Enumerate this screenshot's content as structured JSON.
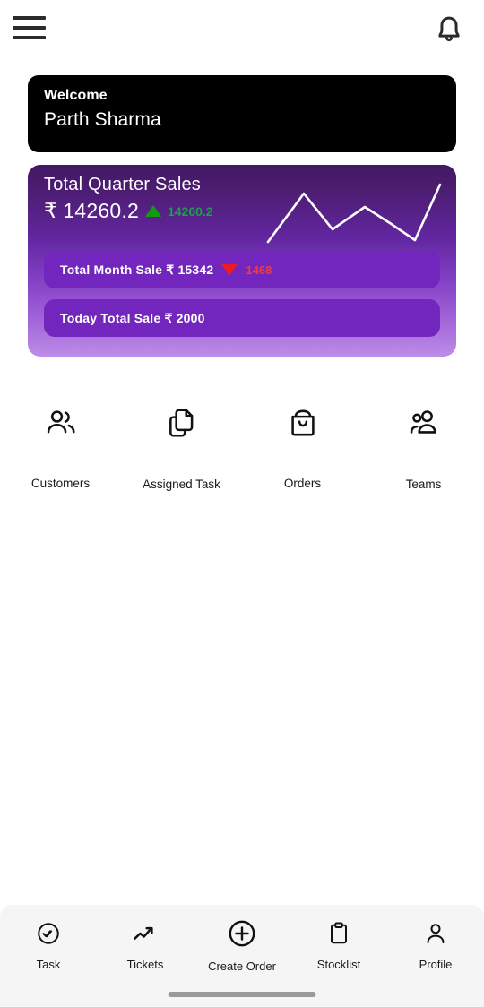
{
  "header": {
    "menu_icon": "hamburger-menu-icon",
    "notification_icon": "bell-icon"
  },
  "welcome": {
    "label": "Welcome",
    "name": "Parth Sharma"
  },
  "sales": {
    "title": "Total Quarter Sales",
    "currency_amount": "₹ 14260.2",
    "delta_value": "14260.2",
    "delta_direction": "up",
    "delta_up_color": "#18a04a",
    "month_row": {
      "text": "Total Month Sale ₹ 15342",
      "delta_value": "1468",
      "delta_direction": "down",
      "delta_down_color": "#ef3b43"
    },
    "today_row": {
      "text": "Today Total Sale ₹ 2000"
    }
  },
  "chart_data": {
    "type": "line",
    "title": "Total Quarter Sales",
    "x": [
      0,
      1,
      2,
      3,
      4,
      5,
      6
    ],
    "values": [
      10,
      72,
      30,
      58,
      34,
      12,
      88
    ],
    "xlabel": "",
    "ylabel": "",
    "ylim": [
      0,
      100
    ],
    "grid": false,
    "legend": "none",
    "line_color": "#ffffff"
  },
  "quick_actions": [
    {
      "label": "Customers",
      "icon": "users-icon"
    },
    {
      "label": "Assigned Task",
      "icon": "documents-copy-icon"
    },
    {
      "label": "Orders",
      "icon": "shopping-bag-icon"
    },
    {
      "label": "Teams",
      "icon": "users-group-icon"
    }
  ],
  "bottom_nav": [
    {
      "label": "Task",
      "icon": "check-circle-icon"
    },
    {
      "label": "Tickets",
      "icon": "trending-up-icon"
    },
    {
      "label": "Create Order",
      "icon": "plus-circle-icon"
    },
    {
      "label": "Stocklist",
      "icon": "clipboard-icon"
    },
    {
      "label": "Profile",
      "icon": "person-icon"
    }
  ]
}
